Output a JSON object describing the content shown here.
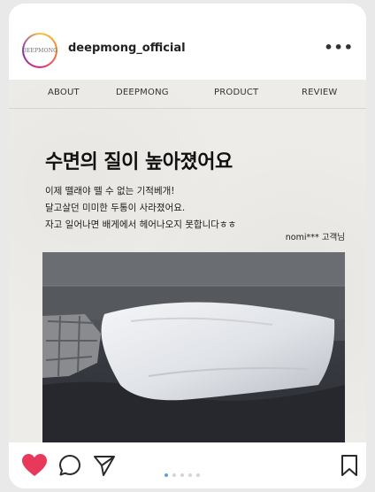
{
  "account": {
    "username": "deepmong_official",
    "avatar_text": "DEEPMONG",
    "more_icon": "more-dots-icon"
  },
  "nav": {
    "items": [
      "ABOUT",
      "DEEPMONG",
      "PRODUCT",
      "REVIEW"
    ]
  },
  "post": {
    "headline": "수면의 질이 높아졌어요",
    "lines": [
      "이제 뗄래야 뗄 수 없는 기적베개!",
      "달고살던 미미한 두통이 사라졌어요.",
      "자고 일어나면 배게에서 헤어나오지 못합니다ㅎㅎ"
    ],
    "reviewer": "nomi*** 고객님"
  },
  "actions": {
    "like_icon": "heart-icon",
    "comment_icon": "comment-icon",
    "share_icon": "send-icon",
    "save_icon": "bookmark-icon",
    "liked_color": "#e8395a"
  },
  "carousel": {
    "current": 1,
    "total": 5
  }
}
